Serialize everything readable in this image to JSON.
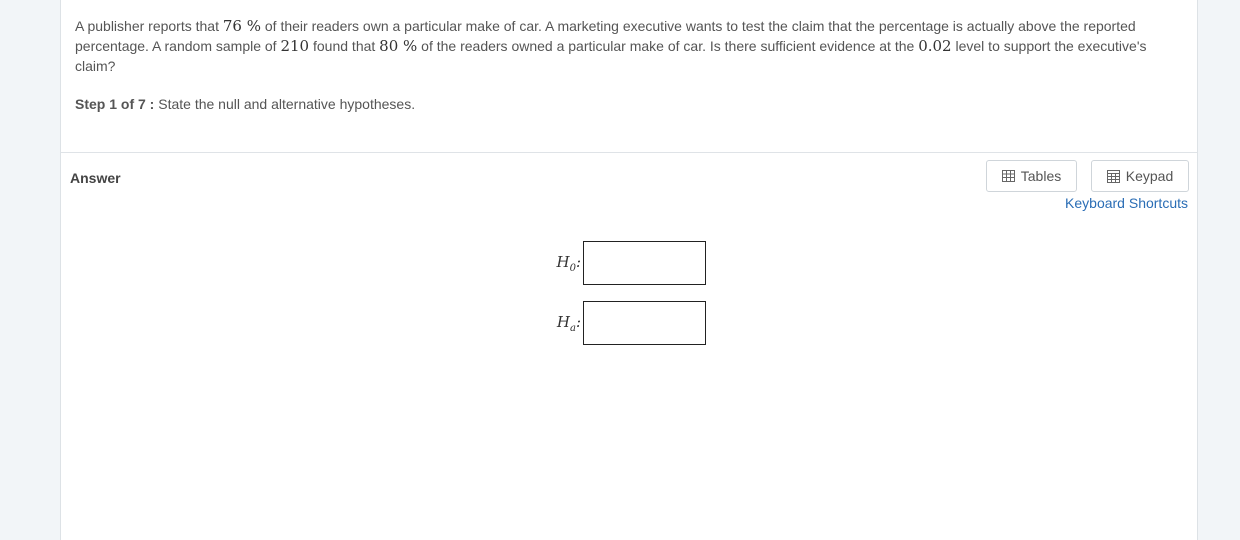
{
  "question": {
    "part1": "A publisher reports that ",
    "p_reported": "76 %",
    "part2": " of their readers own a particular make of car.  A marketing executive wants to test the claim that the percentage is actually above the reported percentage.  A random sample of ",
    "sample_size": "210",
    "part3": " found that ",
    "p_sample": "80 %",
    "part4": " of the readers owned a particular make of car.  Is there sufficient evidence at the ",
    "alpha": "0.02",
    "part5": " level to support the executive's claim?"
  },
  "step": {
    "label": "Step 1 of 7 :",
    "text": " State the null and alternative hypotheses."
  },
  "answer": {
    "label": "Answer",
    "tables_button": "Tables",
    "keypad_button": "Keypad",
    "shortcuts_link": "Keyboard Shortcuts",
    "null_main": "H",
    "null_sub": "0",
    "alt_main": "H",
    "alt_sub": "a",
    "colon": ":",
    "null_value": "",
    "alt_value": ""
  }
}
